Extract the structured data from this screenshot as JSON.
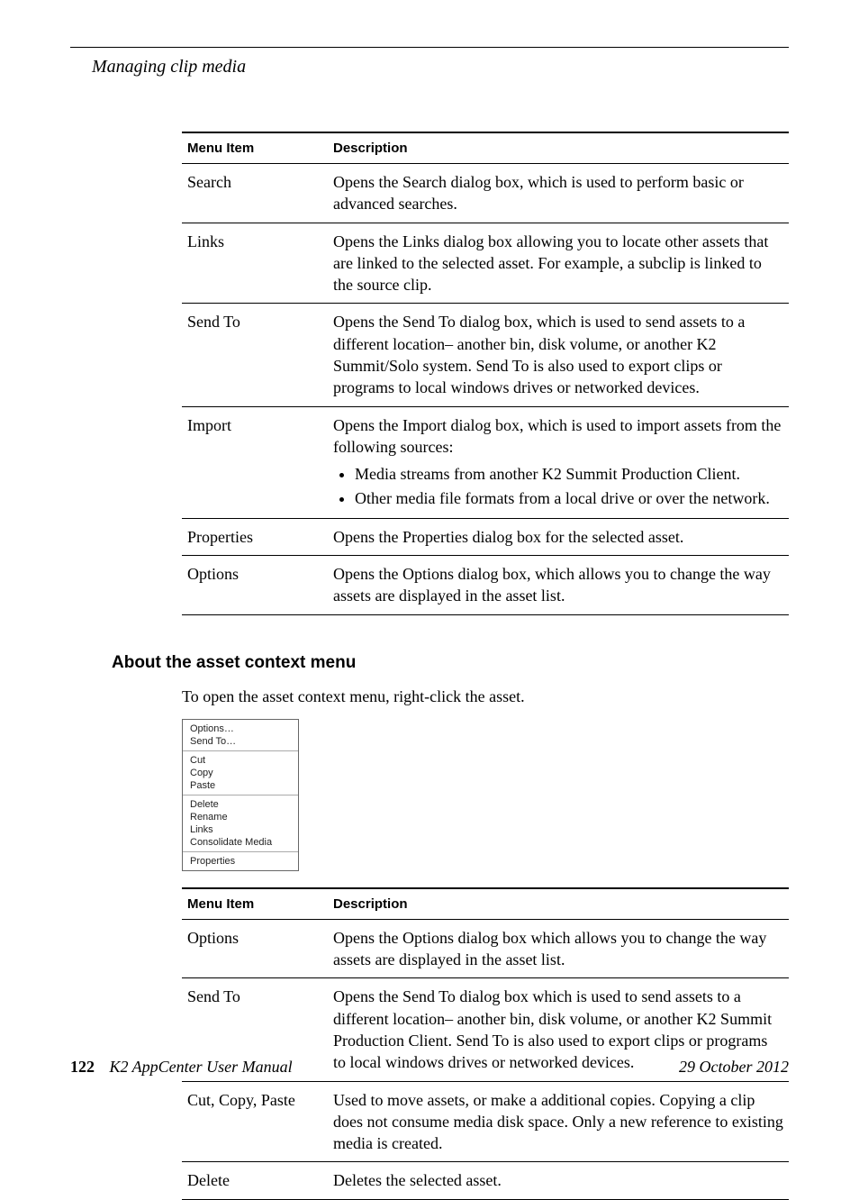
{
  "running_head": "Managing clip media",
  "table1": {
    "headers": {
      "menu": "Menu Item",
      "desc": "Description"
    },
    "rows": [
      {
        "menu": "Search",
        "desc": "Opens the Search dialog box, which is used to perform basic or advanced searches."
      },
      {
        "menu": "Links",
        "desc": "Opens the Links dialog box allowing you to locate other assets that are linked to the selected asset. For example, a subclip is linked to the source clip."
      },
      {
        "menu": "Send To",
        "desc": "Opens the Send To dialog box, which is used to send assets to a different location– another bin, disk volume, or another K2 Summit/Solo system. Send To is also used to export clips or programs to local windows drives or networked devices."
      },
      {
        "menu": "Import",
        "desc_intro": "Opens the Import dialog box, which is used to import assets from the following sources:",
        "bullets": [
          "Media streams from another K2 Summit Production Client.",
          "Other media file formats from a local drive or over the network."
        ]
      },
      {
        "menu": "Properties",
        "desc": "Opens the Properties dialog box for the selected asset."
      },
      {
        "menu": "Options",
        "desc": "Opens the Options dialog box, which allows you to change the way assets are displayed in the asset list."
      }
    ]
  },
  "section_heading": "About the asset context menu",
  "intro_text": "To open the asset context menu, right-click the asset.",
  "context_menu": {
    "groups": [
      [
        "Options…",
        "Send To…"
      ],
      [
        "Cut",
        "Copy",
        "Paste"
      ],
      [
        "Delete",
        "Rename",
        "Links",
        "Consolidate Media"
      ],
      [
        "Properties"
      ]
    ]
  },
  "table2": {
    "headers": {
      "menu": "Menu Item",
      "desc": "Description"
    },
    "rows": [
      {
        "menu": "Options",
        "desc": "Opens the Options dialog box which allows you to change the way assets are displayed in the asset list."
      },
      {
        "menu": "Send To",
        "desc": "Opens the Send To dialog box which is used to send assets to a different location– another bin, disk volume, or another K2 Summit Production Client. Send To is also used to export clips or programs to local windows drives or networked devices."
      },
      {
        "menu": "Cut, Copy, Paste",
        "desc": "Used to move assets, or make a additional copies. Copying a clip does not consume media disk space. Only a new reference to existing media is created."
      },
      {
        "menu": "Delete",
        "desc": "Deletes the selected asset."
      }
    ]
  },
  "footer": {
    "page": "122",
    "manual": "K2 AppCenter User Manual",
    "date": "29 October 2012"
  }
}
